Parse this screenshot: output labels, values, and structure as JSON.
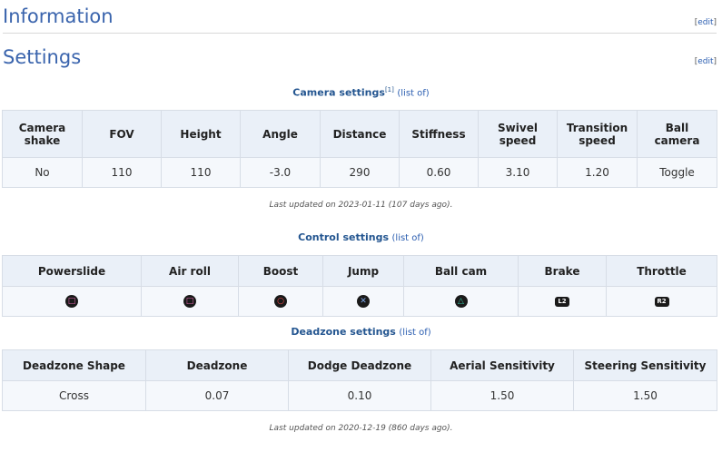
{
  "information": {
    "heading": "Information",
    "edit": "edit"
  },
  "settings": {
    "heading": "Settings",
    "edit": "edit"
  },
  "camera": {
    "title": "Camera settings",
    "ref": "[1]",
    "list_link": "(list of)",
    "headers": [
      "Camera shake",
      "FOV",
      "Height",
      "Angle",
      "Distance",
      "Stiffness",
      "Swivel speed",
      "Transition speed",
      "Ball camera"
    ],
    "values": [
      "No",
      "110",
      "110",
      "-3.0",
      "290",
      "0.60",
      "3.10",
      "1.20",
      "Toggle"
    ],
    "updated": "Last updated on 2023-01-11 (107 days ago)."
  },
  "control": {
    "title": "Control settings",
    "list_link": "(list of)",
    "headers": [
      "Powerslide",
      "Air roll",
      "Boost",
      "Jump",
      "Ball cam",
      "Brake",
      "Throttle"
    ],
    "buttons": [
      {
        "icon": "square-button-icon",
        "glyph": "□",
        "color": "#e667b0"
      },
      {
        "icon": "square-button-icon",
        "glyph": "□",
        "color": "#e667b0"
      },
      {
        "icon": "circle-button-icon",
        "glyph": "○",
        "color": "#ff4f4f"
      },
      {
        "icon": "cross-button-icon",
        "glyph": "✕",
        "color": "#7fa8e8"
      },
      {
        "icon": "triangle-button-icon",
        "glyph": "△",
        "color": "#37c6a5"
      },
      {
        "icon": "l2-trigger-icon",
        "glyph": "L2",
        "color": "#ffffff"
      },
      {
        "icon": "r2-trigger-icon",
        "glyph": "R2",
        "color": "#ffffff"
      }
    ]
  },
  "deadzone": {
    "title": "Deadzone settings",
    "list_link": "(list of)",
    "headers": [
      "Deadzone Shape",
      "Deadzone",
      "Dodge Deadzone",
      "Aerial Sensitivity",
      "Steering Sensitivity"
    ],
    "values": [
      "Cross",
      "0.07",
      "0.10",
      "1.50",
      "1.50"
    ],
    "updated": "Last updated on 2020-12-19 (860 days ago)."
  }
}
